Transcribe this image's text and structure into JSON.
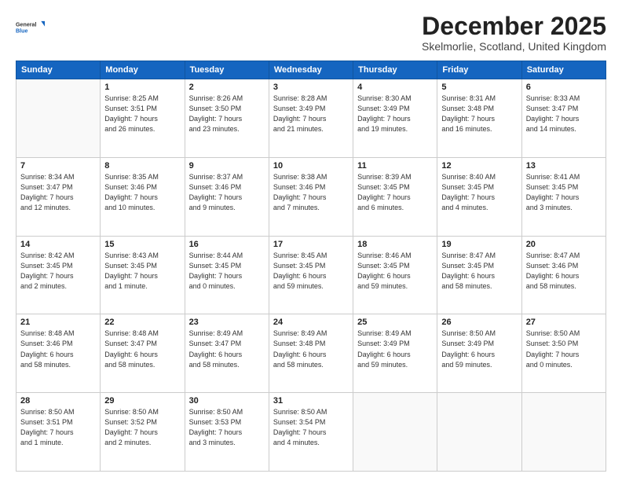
{
  "logo": {
    "general": "General",
    "blue": "Blue"
  },
  "header": {
    "month": "December 2025",
    "location": "Skelmorlie, Scotland, United Kingdom"
  },
  "days_header": [
    "Sunday",
    "Monday",
    "Tuesday",
    "Wednesday",
    "Thursday",
    "Friday",
    "Saturday"
  ],
  "weeks": [
    [
      {
        "num": "",
        "info": ""
      },
      {
        "num": "1",
        "info": "Sunrise: 8:25 AM\nSunset: 3:51 PM\nDaylight: 7 hours\nand 26 minutes."
      },
      {
        "num": "2",
        "info": "Sunrise: 8:26 AM\nSunset: 3:50 PM\nDaylight: 7 hours\nand 23 minutes."
      },
      {
        "num": "3",
        "info": "Sunrise: 8:28 AM\nSunset: 3:49 PM\nDaylight: 7 hours\nand 21 minutes."
      },
      {
        "num": "4",
        "info": "Sunrise: 8:30 AM\nSunset: 3:49 PM\nDaylight: 7 hours\nand 19 minutes."
      },
      {
        "num": "5",
        "info": "Sunrise: 8:31 AM\nSunset: 3:48 PM\nDaylight: 7 hours\nand 16 minutes."
      },
      {
        "num": "6",
        "info": "Sunrise: 8:33 AM\nSunset: 3:47 PM\nDaylight: 7 hours\nand 14 minutes."
      }
    ],
    [
      {
        "num": "7",
        "info": "Sunrise: 8:34 AM\nSunset: 3:47 PM\nDaylight: 7 hours\nand 12 minutes."
      },
      {
        "num": "8",
        "info": "Sunrise: 8:35 AM\nSunset: 3:46 PM\nDaylight: 7 hours\nand 10 minutes."
      },
      {
        "num": "9",
        "info": "Sunrise: 8:37 AM\nSunset: 3:46 PM\nDaylight: 7 hours\nand 9 minutes."
      },
      {
        "num": "10",
        "info": "Sunrise: 8:38 AM\nSunset: 3:46 PM\nDaylight: 7 hours\nand 7 minutes."
      },
      {
        "num": "11",
        "info": "Sunrise: 8:39 AM\nSunset: 3:45 PM\nDaylight: 7 hours\nand 6 minutes."
      },
      {
        "num": "12",
        "info": "Sunrise: 8:40 AM\nSunset: 3:45 PM\nDaylight: 7 hours\nand 4 minutes."
      },
      {
        "num": "13",
        "info": "Sunrise: 8:41 AM\nSunset: 3:45 PM\nDaylight: 7 hours\nand 3 minutes."
      }
    ],
    [
      {
        "num": "14",
        "info": "Sunrise: 8:42 AM\nSunset: 3:45 PM\nDaylight: 7 hours\nand 2 minutes."
      },
      {
        "num": "15",
        "info": "Sunrise: 8:43 AM\nSunset: 3:45 PM\nDaylight: 7 hours\nand 1 minute."
      },
      {
        "num": "16",
        "info": "Sunrise: 8:44 AM\nSunset: 3:45 PM\nDaylight: 7 hours\nand 0 minutes."
      },
      {
        "num": "17",
        "info": "Sunrise: 8:45 AM\nSunset: 3:45 PM\nDaylight: 6 hours\nand 59 minutes."
      },
      {
        "num": "18",
        "info": "Sunrise: 8:46 AM\nSunset: 3:45 PM\nDaylight: 6 hours\nand 59 minutes."
      },
      {
        "num": "19",
        "info": "Sunrise: 8:47 AM\nSunset: 3:45 PM\nDaylight: 6 hours\nand 58 minutes."
      },
      {
        "num": "20",
        "info": "Sunrise: 8:47 AM\nSunset: 3:46 PM\nDaylight: 6 hours\nand 58 minutes."
      }
    ],
    [
      {
        "num": "21",
        "info": "Sunrise: 8:48 AM\nSunset: 3:46 PM\nDaylight: 6 hours\nand 58 minutes."
      },
      {
        "num": "22",
        "info": "Sunrise: 8:48 AM\nSunset: 3:47 PM\nDaylight: 6 hours\nand 58 minutes."
      },
      {
        "num": "23",
        "info": "Sunrise: 8:49 AM\nSunset: 3:47 PM\nDaylight: 6 hours\nand 58 minutes."
      },
      {
        "num": "24",
        "info": "Sunrise: 8:49 AM\nSunset: 3:48 PM\nDaylight: 6 hours\nand 58 minutes."
      },
      {
        "num": "25",
        "info": "Sunrise: 8:49 AM\nSunset: 3:49 PM\nDaylight: 6 hours\nand 59 minutes."
      },
      {
        "num": "26",
        "info": "Sunrise: 8:50 AM\nSunset: 3:49 PM\nDaylight: 6 hours\nand 59 minutes."
      },
      {
        "num": "27",
        "info": "Sunrise: 8:50 AM\nSunset: 3:50 PM\nDaylight: 7 hours\nand 0 minutes."
      }
    ],
    [
      {
        "num": "28",
        "info": "Sunrise: 8:50 AM\nSunset: 3:51 PM\nDaylight: 7 hours\nand 1 minute."
      },
      {
        "num": "29",
        "info": "Sunrise: 8:50 AM\nSunset: 3:52 PM\nDaylight: 7 hours\nand 2 minutes."
      },
      {
        "num": "30",
        "info": "Sunrise: 8:50 AM\nSunset: 3:53 PM\nDaylight: 7 hours\nand 3 minutes."
      },
      {
        "num": "31",
        "info": "Sunrise: 8:50 AM\nSunset: 3:54 PM\nDaylight: 7 hours\nand 4 minutes."
      },
      {
        "num": "",
        "info": ""
      },
      {
        "num": "",
        "info": ""
      },
      {
        "num": "",
        "info": ""
      }
    ]
  ]
}
